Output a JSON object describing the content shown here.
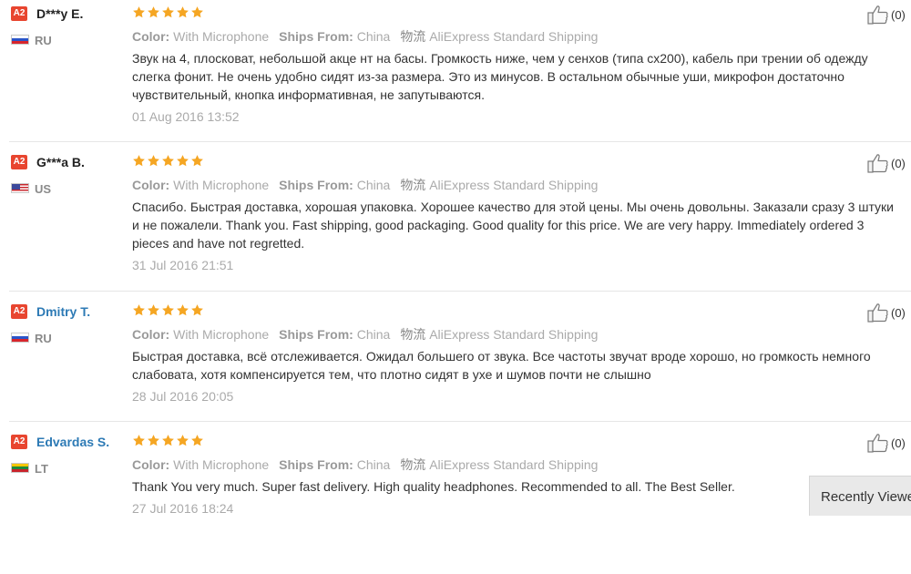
{
  "reviews": [
    {
      "badge": "A2",
      "name": "D***y E.",
      "name_style": "dark",
      "country": "RU",
      "flag": "ru",
      "rating": 5,
      "color_label": "Color:",
      "color_value": "With Microphone",
      "ships_label": "Ships From:",
      "ships_value": "China",
      "shipping_icon": "物流",
      "shipping_method": "AliExpress Standard Shipping",
      "text": "Звук на 4, плосковат, небольшой акце нт на басы. Громкость ниже, чем у сенхов (типа cx200), кабель при трении об одежду слегка фонит. Не очень удобно сидят из-за размера. Это из минусов. В остальном обычные уши, микрофон достаточно чувствительный, кнопка информативная, не запутываются.",
      "date": "01 Aug 2016 13:52",
      "likes": "(0)"
    },
    {
      "badge": "A2",
      "name": "G***a B.",
      "name_style": "dark",
      "country": "US",
      "flag": "us",
      "rating": 5,
      "color_label": "Color:",
      "color_value": "With Microphone",
      "ships_label": "Ships From:",
      "ships_value": "China",
      "shipping_icon": "物流",
      "shipping_method": "AliExpress Standard Shipping",
      "text": "Спасибо. Быстрая доставка, хорошая упаковка. Хорошее качество для этой цены. Мы очень довольны. Заказали сразу 3 штуки и не пожалели. Thank you. Fast shipping, good packaging. Good quality for this price. We are very happy. Immediately ordered 3 pieces and have not regretted.",
      "date": "31 Jul 2016 21:51",
      "likes": "(0)"
    },
    {
      "badge": "A2",
      "name": "Dmitry T.",
      "name_style": "link",
      "country": "RU",
      "flag": "ru",
      "rating": 5,
      "color_label": "Color:",
      "color_value": "With Microphone",
      "ships_label": "Ships From:",
      "ships_value": "China",
      "shipping_icon": "物流",
      "shipping_method": "AliExpress Standard Shipping",
      "text": "Быстрая доставка, всё отслеживается. Ожидал большего от звука. Все частоты звучат вроде хорошо, но громкость немного слабовата, хотя компенсируется тем, что плотно сидят в ухе и шумов почти не слышно",
      "date": "28 Jul 2016 20:05",
      "likes": "(0)"
    },
    {
      "badge": "A2",
      "name": "Edvardas S.",
      "name_style": "link",
      "country": "LT",
      "flag": "lt",
      "rating": 5,
      "color_label": "Color:",
      "color_value": "With Microphone",
      "ships_label": "Ships From:",
      "ships_value": "China",
      "shipping_icon": "物流",
      "shipping_method": "AliExpress Standard Shipping",
      "text": "Thank You very much. Super fast delivery. High quality headphones. Recommended to all. The Best Seller.",
      "date": "27 Jul 2016 18:24",
      "likes": "(0)"
    }
  ],
  "recently_viewed": "Recently Viewed",
  "colors": {
    "star": "#f5a623",
    "badge": "#e8452f",
    "link": "#2d7ab5"
  },
  "icons": {
    "like": "thumbs-up-icon",
    "star": "star-icon"
  }
}
